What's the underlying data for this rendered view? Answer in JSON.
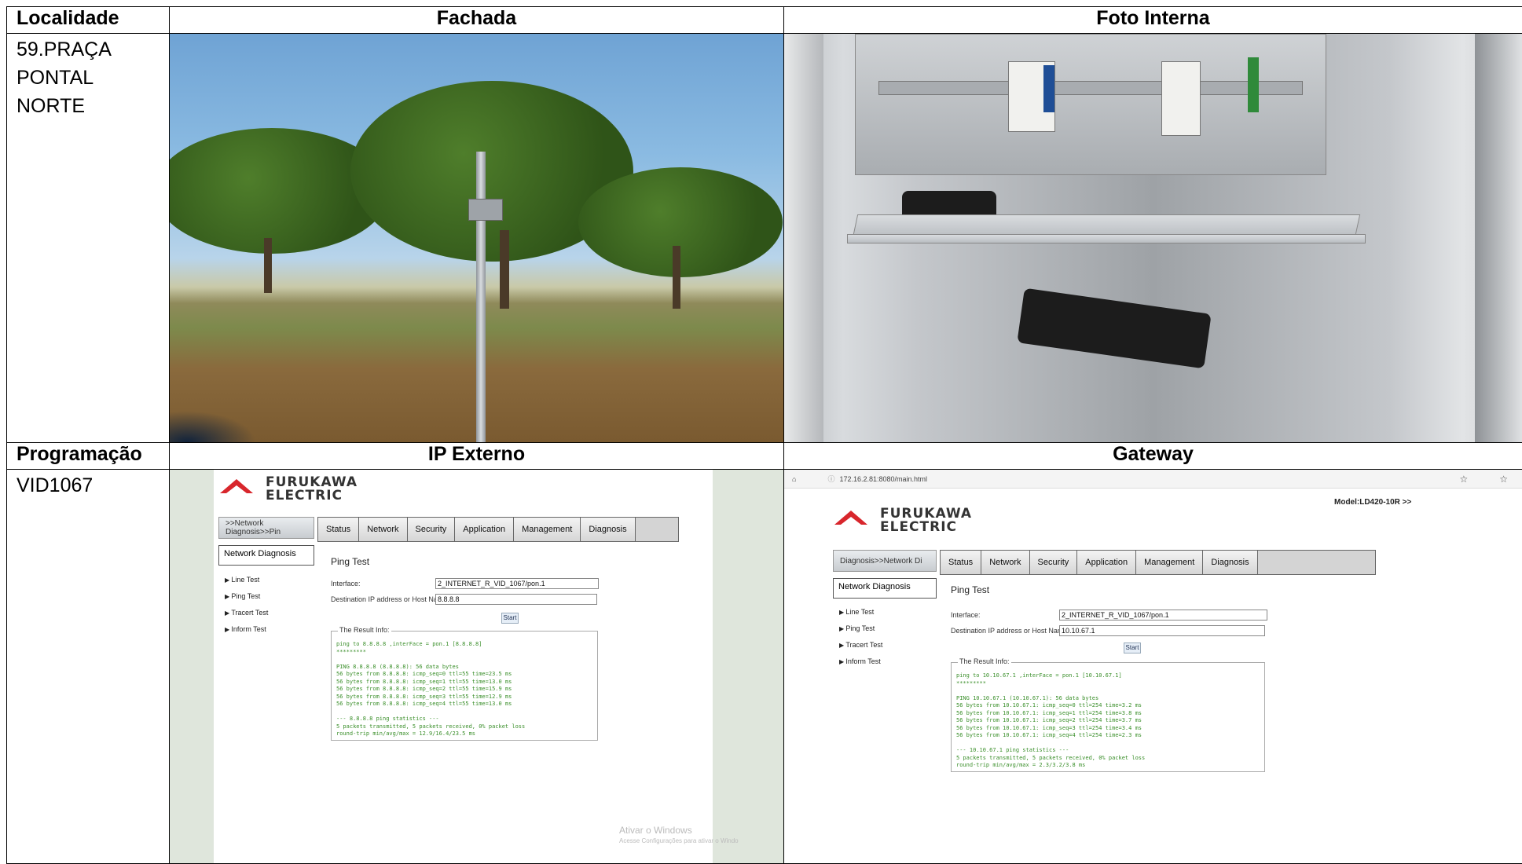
{
  "headers": {
    "localidade": "Localidade",
    "fachada": "Fachada",
    "foto_interna": "Foto Interna",
    "programacao": "Programação",
    "ip_externo": "IP Externo",
    "gateway": "Gateway"
  },
  "location": {
    "line1": "59.PRAÇA",
    "line2": "PONTAL",
    "line3": "NORTE"
  },
  "programacao_value": "VID1067",
  "brand": {
    "line1": "FURUKAWA",
    "line2": "ELECTRIC"
  },
  "ip_externo_shot": {
    "breadcrumb": ">>Network Diagnosis>>Pin",
    "tabs": [
      "Status",
      "Network",
      "Security",
      "Application",
      "Management",
      "Diagnosis"
    ],
    "nav_header": "Network Diagnosis",
    "nav_items": [
      "Line Test",
      "Ping Test",
      "Tracert Test",
      "Inform Test"
    ],
    "title": "Ping Test",
    "interface_label": "Interface:",
    "interface_value": "2_INTERNET_R_VID_1067/pon.1",
    "dest_label": "Destination IP address or Host Name:",
    "dest_value": "8.8.8.8",
    "start": "Start",
    "result_legend": "The Result Info:",
    "result_text": "ping to 8.8.8.8 ,interFace = pon.1 [8.8.8.8]\n*********\n\nPING 8.8.8.8 (8.8.8.8): 56 data bytes\n56 bytes from 8.8.8.8: icmp_seq=0 ttl=55 time=23.5 ms\n56 bytes from 8.8.8.8: icmp_seq=1 ttl=55 time=13.0 ms\n56 bytes from 8.8.8.8: icmp_seq=2 ttl=55 time=15.9 ms\n56 bytes from 8.8.8.8: icmp_seq=3 ttl=55 time=12.9 ms\n56 bytes from 8.8.8.8: icmp_seq=4 ttl=55 time=13.0 ms\n\n--- 8.8.8.8 ping statistics ---\n5 packets transmitted, 5 packets received, 0% packet loss\nround-trip min/avg/max = 12.9/16.4/23.5 ms",
    "watermark_line1": "Ativar o Windows",
    "watermark_line2": "Acesse Configurações para ativar o Windo"
  },
  "gateway_shot": {
    "url": "172.16.2.81:8080/main.html",
    "model": "Model:LD420-10R  >>",
    "breadcrumb": "Diagnosis>>Network Di",
    "tabs": [
      "Status",
      "Network",
      "Security",
      "Application",
      "Management",
      "Diagnosis"
    ],
    "nav_header": "Network Diagnosis",
    "nav_items": [
      "Line Test",
      "Ping Test",
      "Tracert Test",
      "Inform Test"
    ],
    "title": "Ping Test",
    "interface_label": "Interface:",
    "interface_value": "2_INTERNET_R_VID_1067/pon.1",
    "dest_label": "Destination IP address or Host Name:",
    "dest_value": "10.10.67.1",
    "start": "Start",
    "result_legend": "The Result Info:",
    "result_text": "ping to 10.10.67.1 ,interFace = pon.1 [10.10.67.1]\n*********\n\nPING 10.10.67.1 (10.10.67.1): 56 data bytes\n56 bytes from 10.10.67.1: icmp_seq=0 ttl=254 time=3.2 ms\n56 bytes from 10.10.67.1: icmp_seq=1 ttl=254 time=3.8 ms\n56 bytes from 10.10.67.1: icmp_seq=2 ttl=254 time=3.7 ms\n56 bytes from 10.10.67.1: icmp_seq=3 ttl=254 time=3.4 ms\n56 bytes from 10.10.67.1: icmp_seq=4 ttl=254 time=2.3 ms\n\n--- 10.10.67.1 ping statistics ---\n5 packets transmitted, 5 packets received, 0% packet loss\nround-trip min/avg/max = 2.3/3.2/3.8 ms"
  }
}
